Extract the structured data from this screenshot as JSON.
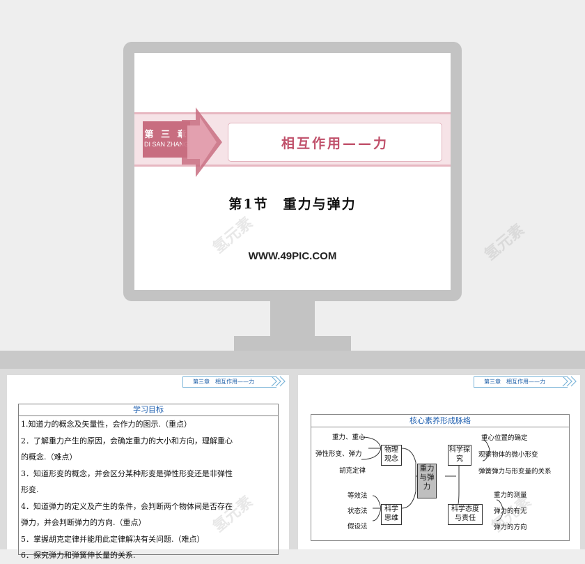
{
  "hero": {
    "chapter_label": "第 三 章",
    "chapter_pinyin": "DI SAN ZHANG",
    "chapter_title": "相互作用——力",
    "section_title": "第1节　重力与弹力",
    "url": "WWW.49PIC.COM",
    "watermark": "氢元素"
  },
  "slide_left": {
    "header": "第三章　相互作用——力",
    "goals_title": "学习目标",
    "goals": [
      "1.知道力的概念及矢量性，会作力的图示.（重点）",
      "2．了解重力产生的原因，会确定重力的大小和方向，理解重心",
      "的概念.（难点）",
      "3．知道形变的概念，并会区分某种形变是弹性形变还是非弹性",
      "形变.",
      "4．知道弹力的定义及产生的条件，会判断两个物体间是否存在",
      "弹力，并会判断弹力的方向.（重点）",
      "5．掌握胡克定律并能用此定律解决有关问题.（难点）",
      "6．探究弹力和弹簧伸长量的关系."
    ]
  },
  "slide_right": {
    "header": "第三章　相互作用——力",
    "map_title": "核心素养形成脉络",
    "center": "重力与弹力",
    "left_top_box": "物理观念",
    "left_top_items": [
      "重力、重心",
      "弹性形变、弹力",
      "胡克定律"
    ],
    "left_bottom_box": "科学思维",
    "left_bottom_items": [
      "等效法",
      "状态法",
      "假设法"
    ],
    "right_top_box": "科学探究",
    "right_top_items": [
      "重心位置的确定",
      "观察物体的微小形变",
      "弹簧弹力与形变量的关系"
    ],
    "right_bottom_box": "科学态度与责任",
    "right_bottom_items": [
      "重力的测量",
      "弹力的有无",
      "弹力的方向"
    ]
  },
  "colors": {
    "accent_pink": "#c86d80",
    "title_pink": "#c0506a",
    "blue_text": "#2060b0",
    "monitor_gray": "#c3c3c3"
  }
}
